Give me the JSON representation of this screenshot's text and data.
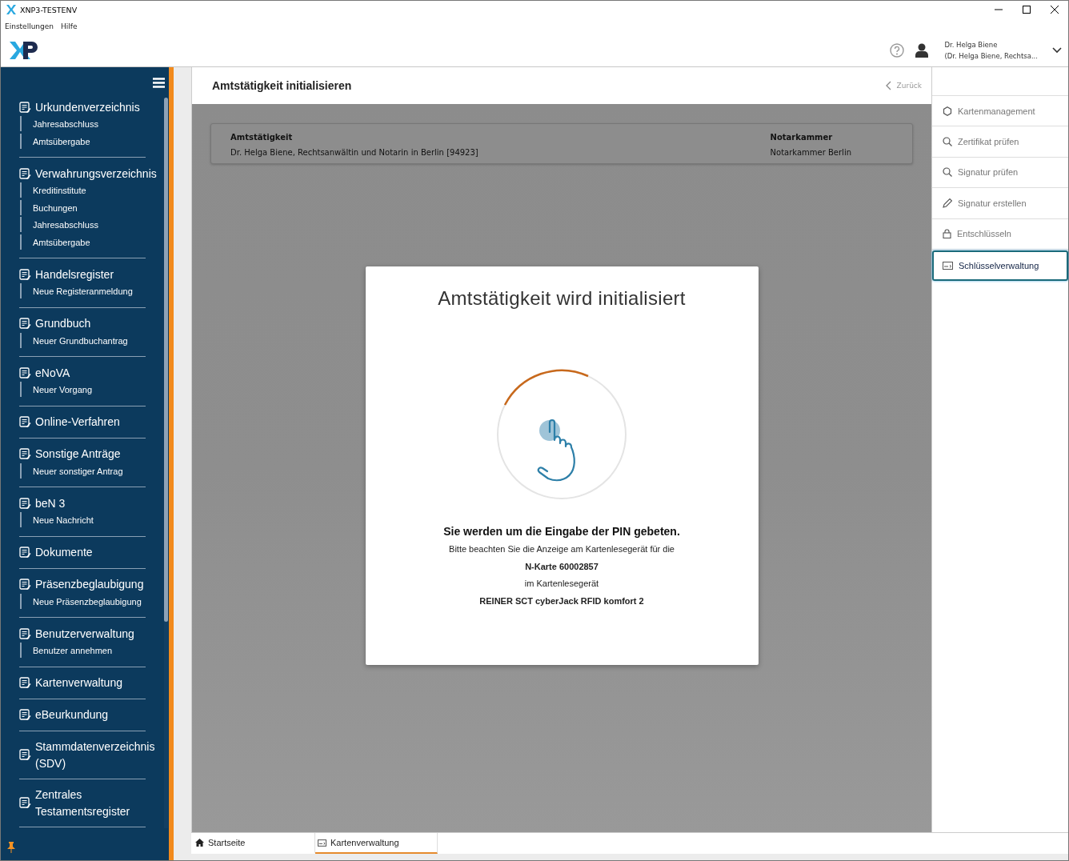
{
  "window": {
    "title": "XNP3-TESTENV"
  },
  "menu": [
    "Einstellungen",
    "Hilfe"
  ],
  "user": {
    "name": "Dr. Helga Biene",
    "role": "(Dr. Helga Biene, Rechtsa..."
  },
  "sidebar": {
    "groups": [
      {
        "title": "Urkundenverzeichnis",
        "children": [
          "Jahresabschluss",
          "Amtsübergabe"
        ]
      },
      {
        "title": "Verwahrungsverzeichnis",
        "children": [
          "Kreditinstitute",
          "Buchungen",
          "Jahresabschluss",
          "Amtsübergabe"
        ]
      },
      {
        "title": "Handelsregister",
        "children": [
          "Neue Registeranmeldung"
        ]
      },
      {
        "title": "Grundbuch",
        "children": [
          "Neuer Grundbuchantrag"
        ]
      },
      {
        "title": "eNoVA",
        "children": [
          "Neuer Vorgang"
        ]
      },
      {
        "title": "Online-Verfahren"
      },
      {
        "title": "Sonstige Anträge",
        "children": [
          "Neuer sonstiger Antrag"
        ]
      },
      {
        "title": "beN 3",
        "children": [
          "Neue Nachricht"
        ]
      },
      {
        "title": "Dokumente"
      },
      {
        "title": "Präsenzbeglaubigung",
        "children": [
          "Neue Präsenzbeglaubigung"
        ]
      },
      {
        "title": "Benutzerverwaltung",
        "children": [
          "Benutzer annehmen"
        ]
      },
      {
        "title": "Kartenverwaltung"
      },
      {
        "title": "eBeurkundung"
      },
      {
        "title": "Stammdatenverzeichnis (SDV)"
      },
      {
        "title": "Zentrales Testamentsregister"
      }
    ]
  },
  "page": {
    "title": "Amtstätigkeit initialisieren",
    "back": "Zurück"
  },
  "info": [
    {
      "label": "Amtstätigkeit",
      "value": "Dr. Helga Biene, Rechtsanwältin und Notarin in Berlin [94923]"
    },
    {
      "label": "Notarkammer",
      "value": "Notarkammer Berlin"
    }
  ],
  "dialog": {
    "title": "Amtstätigkeit wird initialisiert",
    "heading": "Sie werden um die Eingabe der PIN gebeten.",
    "lines": [
      {
        "text": "Bitte beachten Sie die Anzeige am Kartenlesegerät für die",
        "bold": false
      },
      {
        "text": "N-Karte 60002857",
        "bold": true
      },
      {
        "text": "im Kartenlesegerät",
        "bold": false
      },
      {
        "text": "REINER SCT cyberJack RFID komfort 2",
        "bold": true
      }
    ]
  },
  "actions": [
    {
      "label": "Kartenmanagement",
      "selected": false
    },
    {
      "label": "Zertifikat prüfen",
      "selected": false
    },
    {
      "label": "Signatur prüfen",
      "selected": false
    },
    {
      "label": "Signatur erstellen",
      "selected": false
    },
    {
      "label": "Entschlüsseln",
      "selected": false
    },
    {
      "label": "Schlüsselverwaltung",
      "selected": true
    }
  ],
  "bottom_tabs": [
    {
      "label": "Startseite",
      "selected": false
    },
    {
      "label": "Kartenverwaltung",
      "selected": true
    }
  ]
}
